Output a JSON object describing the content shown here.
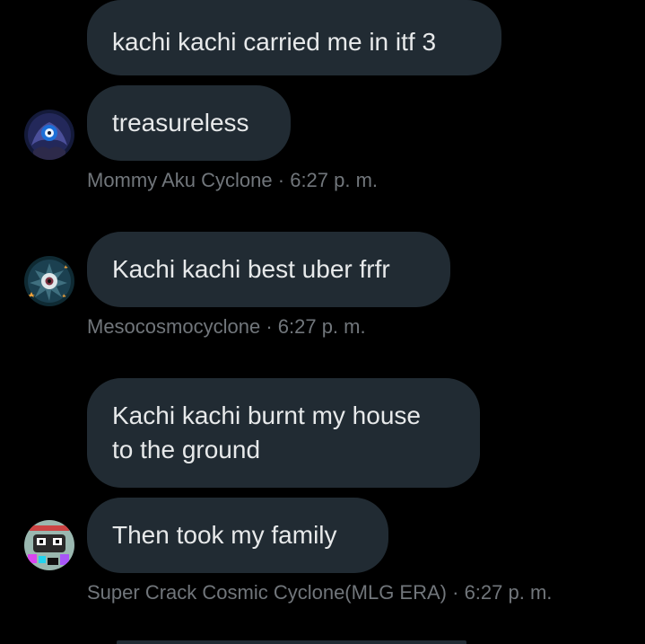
{
  "messages": [
    {
      "bubbles": [
        "kachi kachi carried me in itf 3",
        "treasureless"
      ],
      "sender": "Mommy Aku Cyclone",
      "time": "6:27 p. m.",
      "avatar": "aku-cyclone-avatar"
    },
    {
      "bubbles": [
        "Kachi kachi best uber frfr"
      ],
      "sender": "Mesocosmocyclone",
      "time": "6:27 p. m.",
      "avatar": "mesocosmocyclone-avatar"
    },
    {
      "bubbles": [
        "Kachi kachi burnt my house",
        "to the ground",
        "Then took my family"
      ],
      "sender": "Super Crack Cosmic Cyclone(MLG ERA)",
      "time": "6:27 p. m.",
      "avatar": "super-crack-cyclone-avatar"
    }
  ],
  "separator": "·",
  "colors": {
    "background": "#000000",
    "bubble": "#212b33",
    "text": "#e7e9ea",
    "meta": "#71767b"
  }
}
